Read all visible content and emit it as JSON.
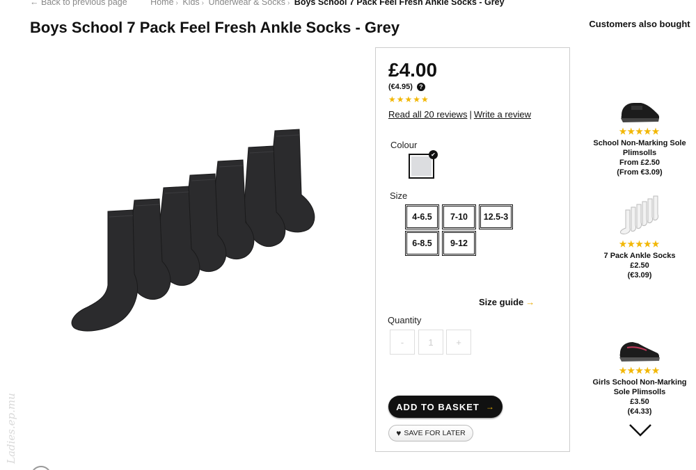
{
  "breadcrumb": {
    "back": "Back to previous page",
    "items": [
      "Home",
      "Kids",
      "Underwear & Socks"
    ],
    "current": "Boys School 7 Pack Feel Fresh Ankle Socks - Grey"
  },
  "product": {
    "title": "Boys School 7 Pack Feel Fresh Ankle Socks - Grey",
    "price": "£4.00",
    "price_eur": "(€4.95)",
    "rating": 4.5,
    "read_reviews": "Read all 20 reviews",
    "write_review": "Write a review",
    "colour_label": "Colour",
    "size_label": "Size",
    "sizes": [
      "4-6.5",
      "7-10",
      "12.5-3",
      "6-8.5",
      "9-12"
    ],
    "size_guide": "Size guide",
    "quantity_label": "Quantity",
    "quantity": "1",
    "minus": "-",
    "plus": "+",
    "add_to_basket": "ADD TO BASKET",
    "save_for_later": "SAVE FOR LATER"
  },
  "also_bought": {
    "title": "Customers also bought",
    "items": [
      {
        "name": "School Non-Marking Sole Plimsolls",
        "price": "From £2.50",
        "price_eur": "(From €3.09)",
        "rating": 4.5
      },
      {
        "name": "7 Pack Ankle Socks",
        "price": "£2.50",
        "price_eur": "(€3.09)",
        "rating": 5
      },
      {
        "name": "Girls School Non-Marking Sole Plimsolls",
        "price": "£3.50",
        "price_eur": "(€4.33)",
        "rating": 5
      }
    ]
  },
  "watermark": "Ladies.ep.mu",
  "colors": {
    "star": "#f2b705",
    "swatch": "#dcdde0",
    "accent_arrow": "#e9a900"
  }
}
